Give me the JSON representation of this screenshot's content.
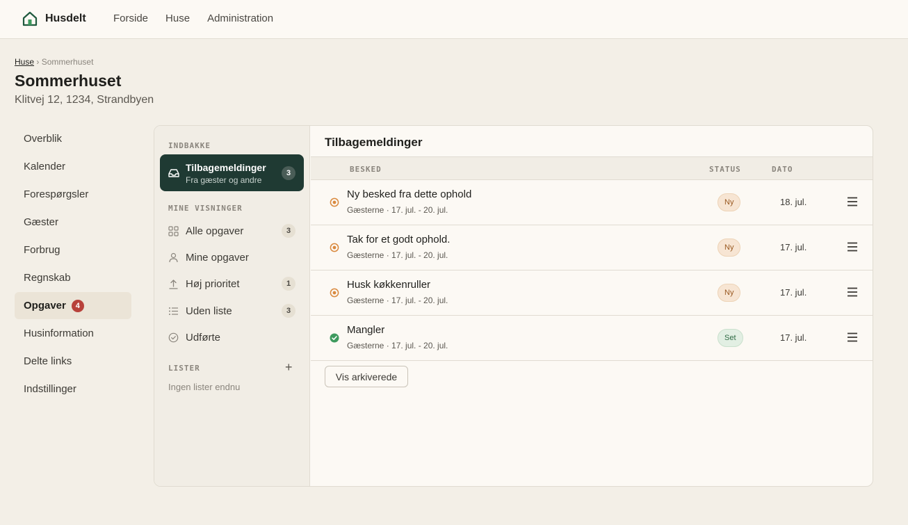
{
  "app": {
    "brand": "Husdelt"
  },
  "nav": {
    "items": [
      "Forside",
      "Huse",
      "Administration"
    ]
  },
  "breadcrumb": {
    "parent": "Huse",
    "separator": "›",
    "current": "Sommerhuset"
  },
  "page": {
    "title": "Sommerhuset",
    "subtitle": "Klitvej 12, 1234, Strandbyen"
  },
  "sidebar": {
    "items": [
      {
        "label": "Overblik"
      },
      {
        "label": "Kalender"
      },
      {
        "label": "Forespørgsler"
      },
      {
        "label": "Gæster"
      },
      {
        "label": "Forbrug"
      },
      {
        "label": "Regnskab"
      },
      {
        "label": "Opgaver",
        "badge": "4",
        "active": true
      },
      {
        "label": "Husinformation"
      },
      {
        "label": "Delte links"
      },
      {
        "label": "Indstillinger"
      }
    ]
  },
  "inbox": {
    "section_label": "INDBAKKE",
    "active": {
      "title": "Tilbagemeldinger",
      "subtitle": "Fra gæster og andre",
      "count": "3"
    },
    "views_label": "MINE VISNINGER",
    "views": [
      {
        "label": "Alle opgaver",
        "count": "3",
        "icon": "grid-icon"
      },
      {
        "label": "Mine opgaver",
        "count": "",
        "icon": "user-icon"
      },
      {
        "label": "Høj prioritet",
        "count": "1",
        "icon": "arrow-up-icon"
      },
      {
        "label": "Uden liste",
        "count": "3",
        "icon": "list-icon"
      },
      {
        "label": "Udførte",
        "count": "",
        "icon": "check-circle-icon"
      }
    ],
    "lists_label": "LISTER",
    "lists_add": "+",
    "lists_empty": "Ingen lister endnu"
  },
  "content": {
    "title": "Tilbagemeldinger",
    "columns": {
      "message": "BESKED",
      "status": "STATUS",
      "date": "DATO"
    },
    "rows": [
      {
        "title": "Ny besked fra dette ophold",
        "meta": "Gæsterne · 17. jul. - 20. jul.",
        "status": "Ny",
        "state": "new",
        "date": "18. jul."
      },
      {
        "title": "Tak for et godt ophold.",
        "meta": "Gæsterne · 17. jul. - 20. jul.",
        "status": "Ny",
        "state": "new",
        "date": "17. jul."
      },
      {
        "title": "Husk køkkenruller",
        "meta": "Gæsterne · 17. jul. - 20. jul.",
        "status": "Ny",
        "state": "new",
        "date": "17. jul."
      },
      {
        "title": "Mangler",
        "meta": "Gæsterne · 17. jul. - 20. jul.",
        "status": "Set",
        "state": "seen",
        "date": "17. jul."
      }
    ],
    "archive_button": "Vis arkiverede"
  },
  "colors": {
    "accent_dark": "#1f3a33",
    "status_new": "#d9893e",
    "status_seen": "#3e9a5e",
    "badge_red": "#b8413a",
    "background": "#f3efe7"
  }
}
